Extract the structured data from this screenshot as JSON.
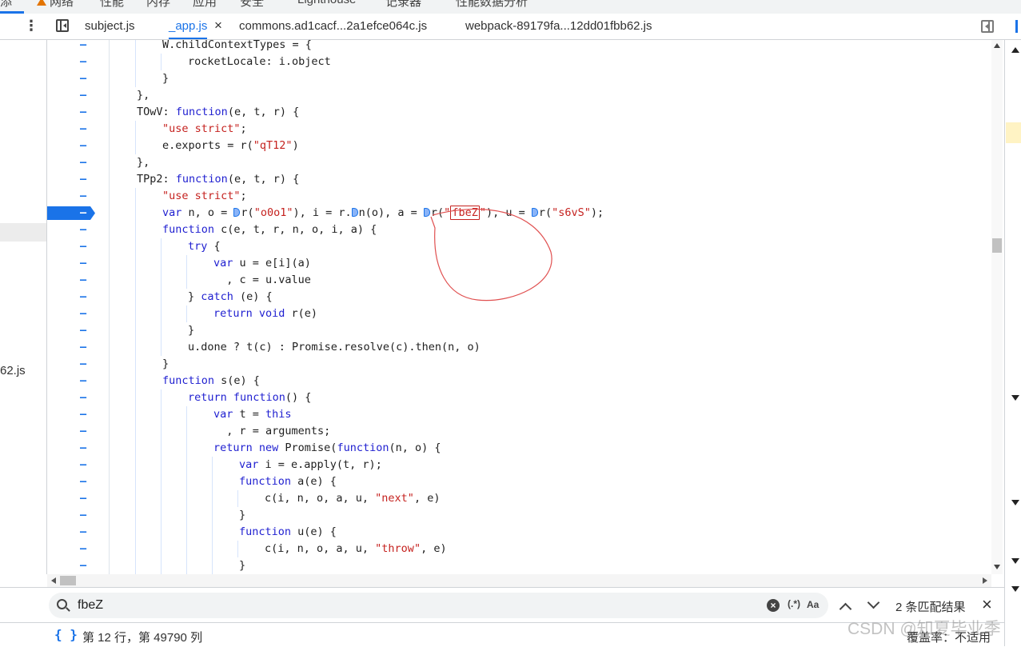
{
  "top_tabs": [
    "添",
    "网络",
    "性能",
    "内存",
    "应用",
    "安全",
    "Lighthouse",
    "记录器",
    "性能数据分析"
  ],
  "file_tabs": [
    {
      "label": "subject.js",
      "active": false
    },
    {
      "label": "_app.js",
      "active": true
    },
    {
      "label": "commons.ad1cacf...2a1efce064c.js",
      "active": false
    },
    {
      "label": "webpack-89179fa...12dd01fbb62.js",
      "active": false
    }
  ],
  "tab_close": "×",
  "navigator": {
    "file_label": "62.js"
  },
  "gutter_marker": "–",
  "code_lines": [
    {
      "indent": 1,
      "parts": [
        {
          "t": "W.childContextTypes = {"
        }
      ]
    },
    {
      "indent": 2,
      "parts": [
        {
          "t": "rocketLocale: i.object"
        }
      ]
    },
    {
      "indent": 1,
      "parts": [
        {
          "t": "}"
        }
      ]
    },
    {
      "indent": 0,
      "parts": [
        {
          "t": "},"
        }
      ]
    },
    {
      "indent": 0,
      "parts": [
        {
          "t": "TOwV: "
        },
        {
          "t": "function",
          "c": "kw"
        },
        {
          "t": "(e, t, r) {"
        }
      ]
    },
    {
      "indent": 1,
      "parts": [
        {
          "t": "\"use strict\"",
          "c": "str"
        },
        {
          "t": ";"
        }
      ]
    },
    {
      "indent": 1,
      "parts": [
        {
          "t": "e.exports = r("
        },
        {
          "t": "\"qT12\"",
          "c": "str"
        },
        {
          "t": ")"
        }
      ]
    },
    {
      "indent": 0,
      "parts": [
        {
          "t": "},"
        }
      ]
    },
    {
      "indent": 0,
      "parts": [
        {
          "t": "TPp2: "
        },
        {
          "t": "function",
          "c": "kw"
        },
        {
          "t": "(e, t, r) {"
        }
      ]
    },
    {
      "indent": 1,
      "parts": [
        {
          "t": "\"use strict\"",
          "c": "str"
        },
        {
          "t": ";"
        }
      ]
    },
    {
      "indent": 1,
      "breakpoint": true,
      "parts": [
        {
          "t": "var",
          "c": "kw"
        },
        {
          "t": " n, o = "
        },
        {
          "m": true
        },
        {
          "t": "r("
        },
        {
          "t": "\"o0o1\"",
          "c": "str"
        },
        {
          "t": "), i = r."
        },
        {
          "m": true
        },
        {
          "t": "n(o), a = "
        },
        {
          "m": true
        },
        {
          "t": "r("
        },
        {
          "t": "\"",
          "c": "str"
        },
        {
          "t": "fbeZ",
          "c": "str",
          "hl": true
        },
        {
          "t": "\"",
          "c": "str"
        },
        {
          "t": "), u = "
        },
        {
          "m": true
        },
        {
          "t": "r("
        },
        {
          "t": "\"s6vS\"",
          "c": "str"
        },
        {
          "t": ");"
        }
      ]
    },
    {
      "indent": 1,
      "parts": [
        {
          "t": "function",
          "c": "kw"
        },
        {
          "t": " c(e, t, r, n, o, i, a) {"
        }
      ]
    },
    {
      "indent": 2,
      "parts": [
        {
          "t": "try",
          "c": "kw"
        },
        {
          "t": " {"
        }
      ]
    },
    {
      "indent": 3,
      "parts": [
        {
          "t": "var",
          "c": "kw"
        },
        {
          "t": " u = e[i](a)"
        }
      ]
    },
    {
      "indent": 3,
      "pad": "  ",
      "parts": [
        {
          "t": ", c = u.value"
        }
      ]
    },
    {
      "indent": 2,
      "parts": [
        {
          "t": "} "
        },
        {
          "t": "catch",
          "c": "kw"
        },
        {
          "t": " (e) {"
        }
      ]
    },
    {
      "indent": 3,
      "parts": [
        {
          "t": "return void",
          "c": "kw"
        },
        {
          "t": " r(e)"
        }
      ]
    },
    {
      "indent": 2,
      "parts": [
        {
          "t": "}"
        }
      ]
    },
    {
      "indent": 2,
      "parts": [
        {
          "t": "u.done ? t(c) : Promise.resolve(c).then(n, o)"
        }
      ]
    },
    {
      "indent": 1,
      "parts": [
        {
          "t": "}"
        }
      ]
    },
    {
      "indent": 1,
      "parts": [
        {
          "t": "function",
          "c": "kw"
        },
        {
          "t": " s(e) {"
        }
      ]
    },
    {
      "indent": 2,
      "parts": [
        {
          "t": "return function",
          "c": "kw"
        },
        {
          "t": "() {"
        }
      ]
    },
    {
      "indent": 3,
      "parts": [
        {
          "t": "var",
          "c": "kw"
        },
        {
          "t": " t = "
        },
        {
          "t": "this",
          "c": "kw"
        }
      ]
    },
    {
      "indent": 3,
      "pad": "  ",
      "parts": [
        {
          "t": ", r = arguments;"
        }
      ]
    },
    {
      "indent": 3,
      "parts": [
        {
          "t": "return new",
          "c": "kw"
        },
        {
          "t": " Promise("
        },
        {
          "t": "function",
          "c": "kw"
        },
        {
          "t": "(n, o) {"
        }
      ]
    },
    {
      "indent": 4,
      "parts": [
        {
          "t": "var",
          "c": "kw"
        },
        {
          "t": " i = e.apply(t, r);"
        }
      ]
    },
    {
      "indent": 4,
      "parts": [
        {
          "t": "function",
          "c": "kw"
        },
        {
          "t": " a(e) {"
        }
      ]
    },
    {
      "indent": 5,
      "parts": [
        {
          "t": "c(i, n, o, a, u, "
        },
        {
          "t": "\"next\"",
          "c": "str"
        },
        {
          "t": ", e)"
        }
      ]
    },
    {
      "indent": 4,
      "parts": [
        {
          "t": "}"
        }
      ]
    },
    {
      "indent": 4,
      "parts": [
        {
          "t": "function",
          "c": "kw"
        },
        {
          "t": " u(e) {"
        }
      ]
    },
    {
      "indent": 5,
      "parts": [
        {
          "t": "c(i, n, o, a, u, "
        },
        {
          "t": "\"throw\"",
          "c": "str"
        },
        {
          "t": ", e)"
        }
      ]
    },
    {
      "indent": 4,
      "parts": [
        {
          "t": "}"
        }
      ]
    }
  ],
  "search": {
    "value": "fbeZ",
    "clear": "×",
    "regex_label": "(.*)",
    "case_label": "Aa",
    "match_count": "2 条匹配结果",
    "close": "×"
  },
  "status": {
    "pretty_print": "{ }",
    "cursor_position": "第 12 行，第 49790 列",
    "coverage": "覆盖率：不适用"
  },
  "watermark": "CSDN @知夏毕业季",
  "colors": {
    "accent": "#1a73e8",
    "keyword": "#1f1fd0",
    "string": "#c5221f",
    "annotation": "#e05050"
  }
}
